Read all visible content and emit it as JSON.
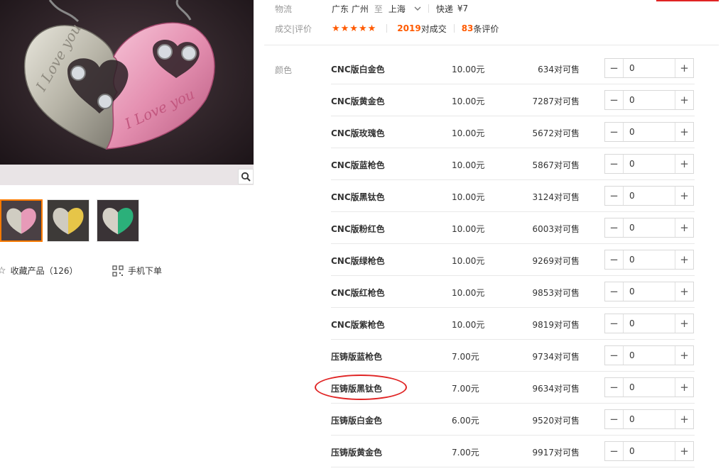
{
  "logistics": {
    "label": "物流",
    "origin": "广东 广州",
    "to": "至",
    "destination": "上海",
    "shipping_method": "快递",
    "shipping_fee": "¥7"
  },
  "deals": {
    "label": "成交|评价",
    "stars": "★★★★★",
    "sold_count": "2019",
    "sold_unit": "对成交",
    "review_count": "83",
    "review_unit": "条评价"
  },
  "gallery": {
    "main_image_text_left": "I Love you",
    "main_image_text_right": "I Love you"
  },
  "actions": {
    "favorite_label": "收藏产品（126）",
    "mobile_order_label": "手机下单"
  },
  "color_label": "颜色",
  "skus": [
    {
      "name": "CNC版白金色",
      "price": "10.00元",
      "stock": "634对可售",
      "qty": "0"
    },
    {
      "name": "CNC版黄金色",
      "price": "10.00元",
      "stock": "7287对可售",
      "qty": "0"
    },
    {
      "name": "CNC版玫瑰色",
      "price": "10.00元",
      "stock": "5672对可售",
      "qty": "0"
    },
    {
      "name": "CNC版蓝枪色",
      "price": "10.00元",
      "stock": "5867对可售",
      "qty": "0"
    },
    {
      "name": "CNC版黑钛色",
      "price": "10.00元",
      "stock": "3124对可售",
      "qty": "0"
    },
    {
      "name": "CNC版粉红色",
      "price": "10.00元",
      "stock": "6003对可售",
      "qty": "0"
    },
    {
      "name": "CNC版绿枪色",
      "price": "10.00元",
      "stock": "9269对可售",
      "qty": "0"
    },
    {
      "name": "CNC版红枪色",
      "price": "10.00元",
      "stock": "9853对可售",
      "qty": "0"
    },
    {
      "name": "CNC版紫枪色",
      "price": "10.00元",
      "stock": "9819对可售",
      "qty": "0"
    },
    {
      "name": "压铸版蓝枪色",
      "price": "7.00元",
      "stock": "9734对可售",
      "qty": "0"
    },
    {
      "name": "压铸版黑钛色",
      "price": "7.00元",
      "stock": "9634对可售",
      "qty": "0"
    },
    {
      "name": "压铸版白金色",
      "price": "6.00元",
      "stock": "9520对可售",
      "qty": "0"
    },
    {
      "name": "压铸版黄金色",
      "price": "7.00元",
      "stock": "9917对可售",
      "qty": "0"
    }
  ],
  "stepper_icons": {
    "minus": "−",
    "plus": "+"
  },
  "colors": {
    "accent": "#ff5a00",
    "highlight": "#e02424",
    "thumb_active": "#ff7a00"
  }
}
